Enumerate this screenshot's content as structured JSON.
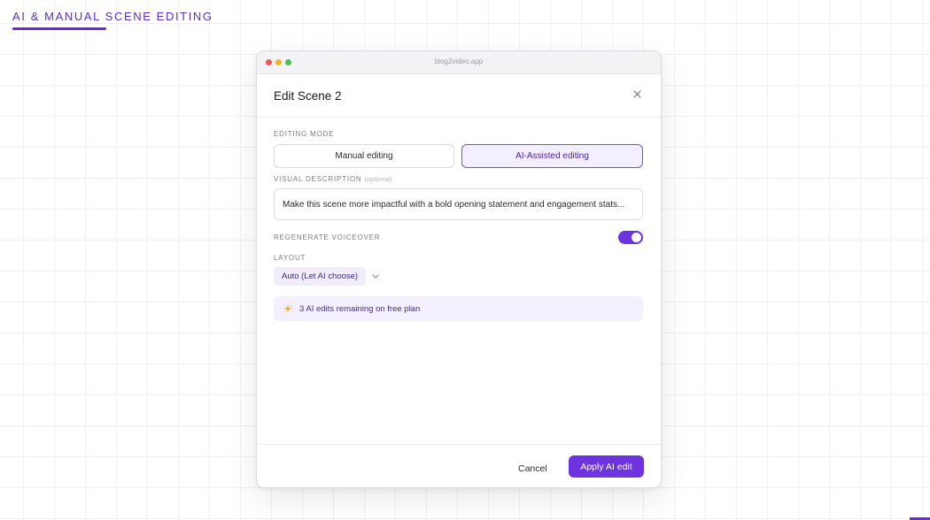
{
  "section": {
    "heading": "AI & MANUAL SCENE EDITING"
  },
  "window": {
    "url": "blog2video.app"
  },
  "dialog": {
    "title": "Edit Scene 2",
    "editing_mode": {
      "label": "EDITING MODE",
      "options": [
        "Manual editing",
        "AI-Assisted editing"
      ],
      "selected": "AI-Assisted editing"
    },
    "visual_description": {
      "label": "VISUAL DESCRIPTION",
      "optional_note": "(optional)",
      "value": "Make this scene more impactful with a bold opening statement and engagement stats..."
    },
    "regenerate_voiceover": {
      "label": "REGENERATE VOICEOVER",
      "enabled": true
    },
    "layout": {
      "label": "LAYOUT",
      "selected": "Auto (Let AI choose)"
    },
    "info_banner": {
      "icon": "sparkles-icon",
      "text": "3 AI edits remaining on free plan"
    },
    "footer": {
      "cancel_label": "Cancel",
      "apply_label": "Apply AI edit"
    }
  },
  "colors": {
    "accent": "#6d33e0",
    "accent_light": "#f4efff",
    "heading": "#5b2cc9"
  }
}
